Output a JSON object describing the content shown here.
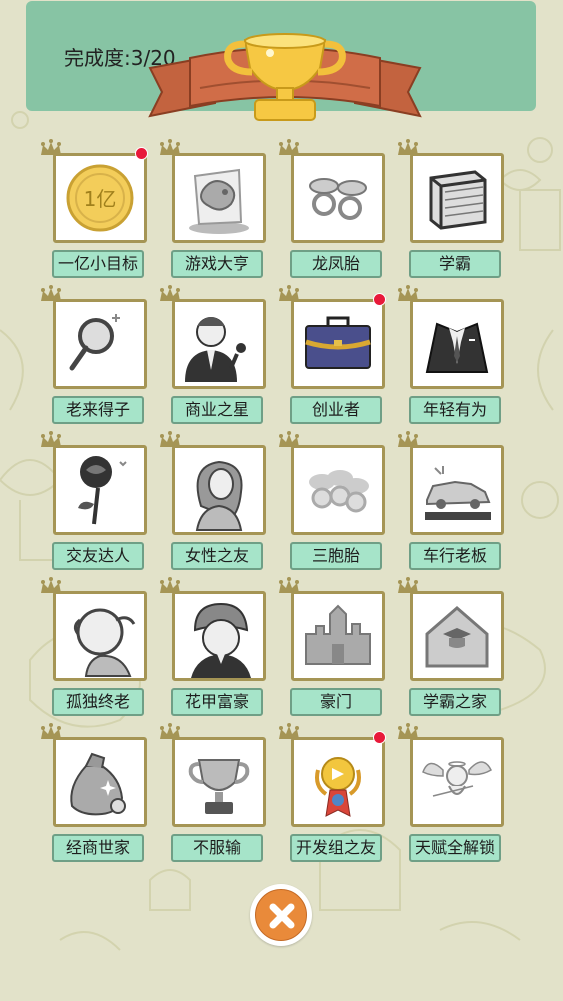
{
  "header": {
    "progress_text": "完成度:3/20"
  },
  "achievements": [
    {
      "label": "一亿小目标",
      "icon": "coin-icon",
      "unlocked": true,
      "new": true
    },
    {
      "label": "游戏大亨",
      "icon": "gamepad-icon",
      "unlocked": false,
      "new": false
    },
    {
      "label": "龙凤胎",
      "icon": "twin-pacifiers-icon",
      "unlocked": false,
      "new": false
    },
    {
      "label": "学霸",
      "icon": "book-icon",
      "unlocked": false,
      "new": false
    },
    {
      "label": "老来得子",
      "icon": "magnifier-icon",
      "unlocked": false,
      "new": false
    },
    {
      "label": "商业之星",
      "icon": "speaker-man-icon",
      "unlocked": true,
      "new": false
    },
    {
      "label": "创业者",
      "icon": "briefcase-icon",
      "unlocked": true,
      "new": true
    },
    {
      "label": "年轻有为",
      "icon": "suit-icon",
      "unlocked": false,
      "new": false
    },
    {
      "label": "交友达人",
      "icon": "rose-icon",
      "unlocked": false,
      "new": false
    },
    {
      "label": "女性之友",
      "icon": "woman-icon",
      "unlocked": false,
      "new": false
    },
    {
      "label": "三胞胎",
      "icon": "triple-pacifiers-icon",
      "unlocked": false,
      "new": false
    },
    {
      "label": "车行老板",
      "icon": "car-icon",
      "unlocked": false,
      "new": false
    },
    {
      "label": "孤独终老",
      "icon": "old-man-icon",
      "unlocked": false,
      "new": false
    },
    {
      "label": "花甲富豪",
      "icon": "rich-old-man-icon",
      "unlocked": false,
      "new": false
    },
    {
      "label": "豪门",
      "icon": "castle-icon",
      "unlocked": false,
      "new": false
    },
    {
      "label": "学霸之家",
      "icon": "scholar-house-icon",
      "unlocked": false,
      "new": false
    },
    {
      "label": "经商世家",
      "icon": "money-bag-icon",
      "unlocked": false,
      "new": false
    },
    {
      "label": "不服输",
      "icon": "trophy-cup-icon",
      "unlocked": false,
      "new": false
    },
    {
      "label": "开发组之友",
      "icon": "medal-icon",
      "unlocked": true,
      "new": true
    },
    {
      "label": "天赋全解锁",
      "icon": "cupid-icon",
      "unlocked": false,
      "new": false
    }
  ],
  "colors": {
    "background": "#e2e2c9",
    "header": "#87c4a4",
    "label_bg": "#a6e4c9",
    "frame_border": "#a59555",
    "new_dot": "#e8193a",
    "close_button": "#e98a3a"
  }
}
